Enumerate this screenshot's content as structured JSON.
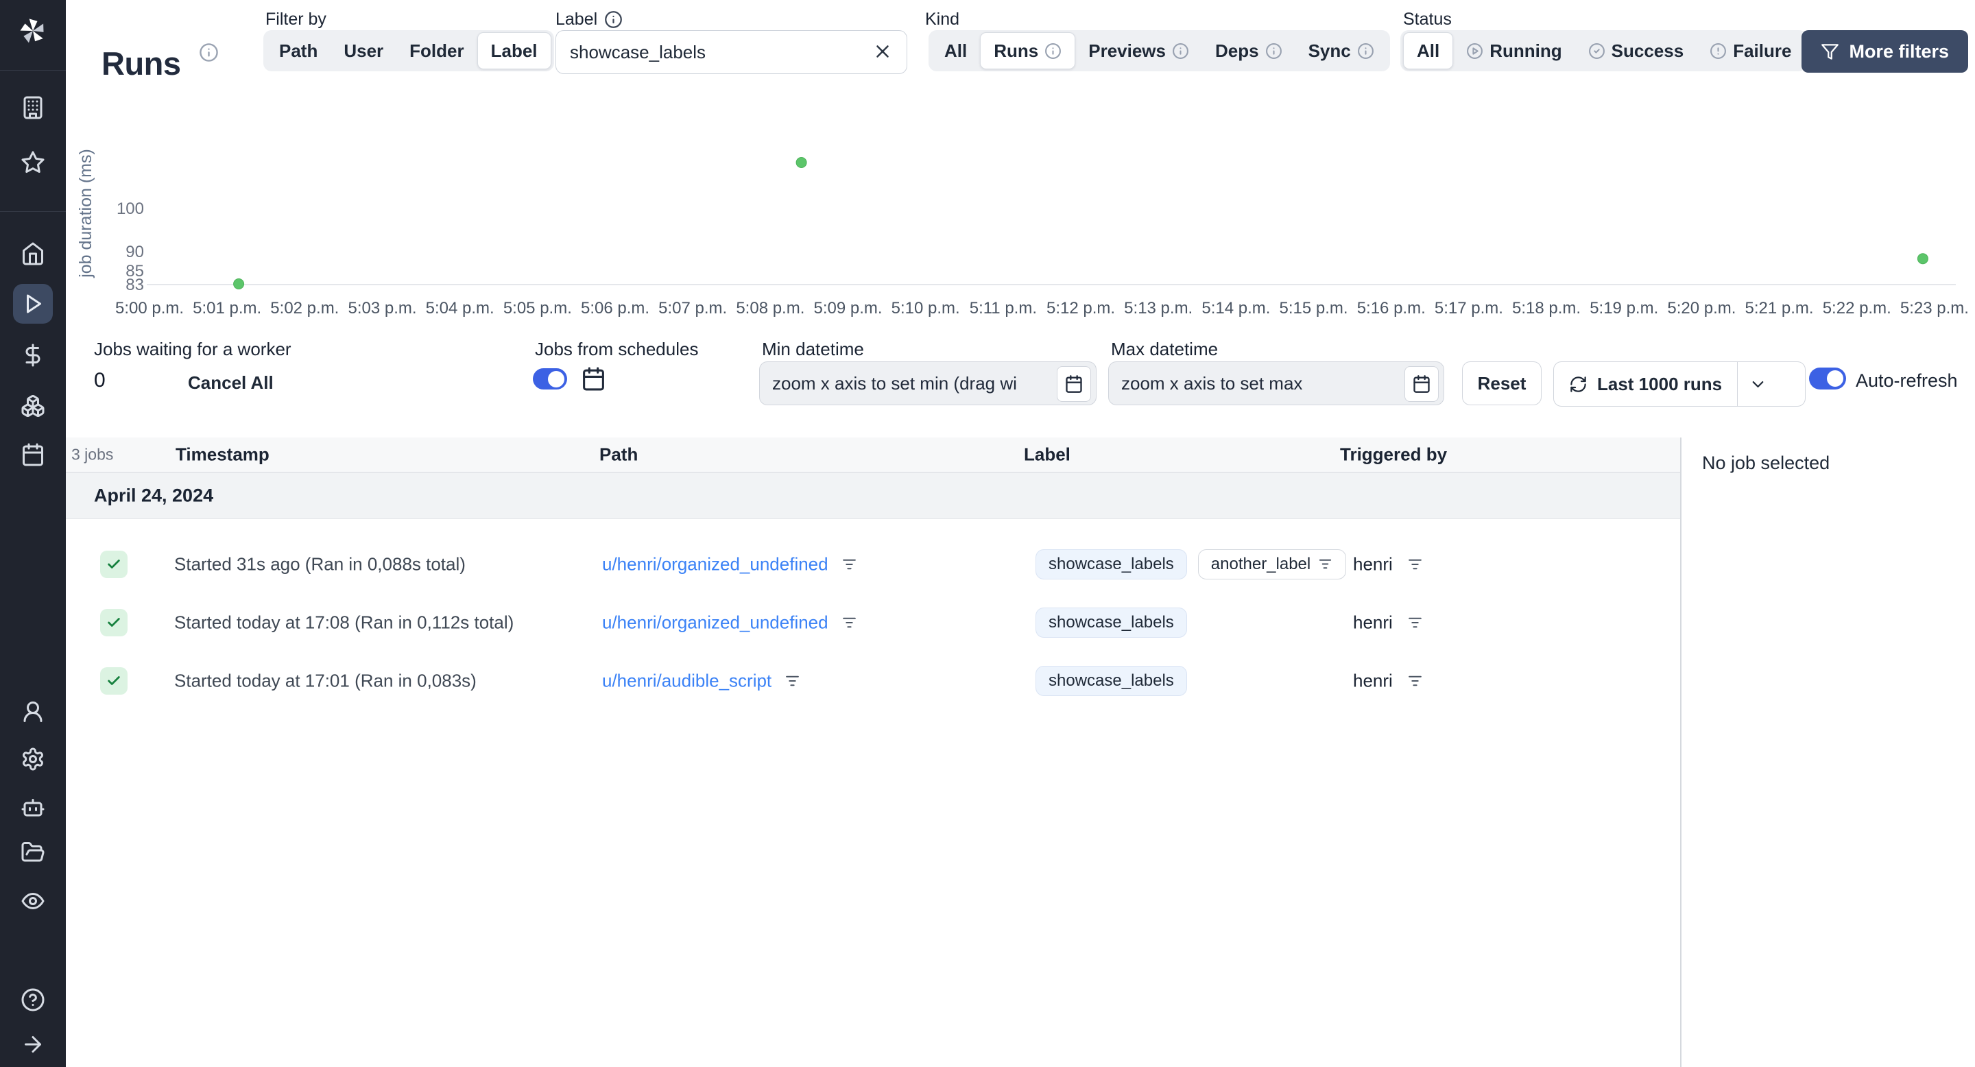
{
  "sidebar": {
    "items": [
      "workspace",
      "favorites",
      "home",
      "runs",
      "variables",
      "resources",
      "schedules",
      "users",
      "settings",
      "workers",
      "folders",
      "audit-logs",
      "help",
      "expand"
    ],
    "active": "runs"
  },
  "header": {
    "title": "Runs",
    "filter_by": {
      "label": "Filter by",
      "options": [
        "Path",
        "User",
        "Folder",
        "Label"
      ],
      "selected": "Label"
    },
    "label_filter": {
      "label": "Label",
      "value": "showcase_labels"
    },
    "kind": {
      "label": "Kind",
      "options": [
        {
          "label": "All"
        },
        {
          "label": "Runs",
          "info": true
        },
        {
          "label": "Previews",
          "info": true
        },
        {
          "label": "Deps",
          "info": true
        },
        {
          "label": "Sync",
          "info": true
        }
      ],
      "selected": "Runs"
    },
    "status": {
      "label": "Status",
      "options": [
        {
          "label": "All"
        },
        {
          "label": "Running",
          "icon": "play-circle"
        },
        {
          "label": "Success",
          "icon": "check-circle"
        },
        {
          "label": "Failure",
          "icon": "alert-circle"
        }
      ],
      "selected": "All"
    },
    "more_filters": "More filters"
  },
  "chart_data": {
    "type": "scatter",
    "title": "",
    "ylabel": "job duration (ms)",
    "xlabel": "",
    "grid": false,
    "legend": false,
    "x_ticks": [
      "5:00 p.m.",
      "5:01 p.m.",
      "5:02 p.m.",
      "5:03 p.m.",
      "5:04 p.m.",
      "5:05 p.m.",
      "5:06 p.m.",
      "5:07 p.m.",
      "5:08 p.m.",
      "5:09 p.m.",
      "5:10 p.m.",
      "5:11 p.m.",
      "5:12 p.m.",
      "5:13 p.m.",
      "5:14 p.m.",
      "5:15 p.m.",
      "5:16 p.m.",
      "5:17 p.m.",
      "5:18 p.m.",
      "5:19 p.m.",
      "5:20 p.m.",
      "5:21 p.m.",
      "5:22 p.m.",
      "5:23 p.m."
    ],
    "y_ticks": [
      83,
      85,
      90,
      100
    ],
    "ylim": [
      83,
      115
    ],
    "points": [
      {
        "x": "5:01 p.m.",
        "minute": 1.15,
        "duration_ms": 83
      },
      {
        "x": "5:08 p.m.",
        "minute": 8.4,
        "duration_ms": 112
      },
      {
        "x": "5:23 p.m.",
        "minute": 22.85,
        "duration_ms": 88
      }
    ],
    "point_color": "#5cc56a"
  },
  "controls": {
    "jobs_waiting": {
      "label": "Jobs waiting for a worker",
      "value": "0",
      "cancel": "Cancel All"
    },
    "schedules": {
      "label": "Jobs from schedules",
      "enabled": true
    },
    "min_datetime": {
      "label": "Min datetime",
      "placeholder": "zoom x axis to set min (drag wi"
    },
    "max_datetime": {
      "label": "Max datetime",
      "placeholder": "zoom x axis to set max"
    },
    "reset": "Reset",
    "runs_window": "Last 1000 runs",
    "auto_refresh": {
      "label": "Auto-refresh",
      "enabled": true
    }
  },
  "jobs": {
    "count": "3 jobs",
    "columns": [
      "Timestamp",
      "Path",
      "Label",
      "Triggered by"
    ],
    "group_date": "April 24, 2024",
    "rows": [
      {
        "status": "success",
        "timestamp": "Started 31s ago (Ran in 0,088s total)",
        "path": "u/henri/organized_undefined",
        "labels": [
          "showcase_labels",
          "another_label"
        ],
        "triggered_by": "henri"
      },
      {
        "status": "success",
        "timestamp": "Started today at 17:08 (Ran in 0,112s total)",
        "path": "u/henri/organized_undefined",
        "labels": [
          "showcase_labels"
        ],
        "triggered_by": "henri"
      },
      {
        "status": "success",
        "timestamp": "Started today at 17:01 (Ran in 0,083s)",
        "path": "u/henri/audible_script",
        "labels": [
          "showcase_labels"
        ],
        "triggered_by": "henri"
      }
    ]
  },
  "detail_panel": {
    "empty": "No job selected"
  },
  "colors": {
    "accent_blue": "#3c61e4",
    "link_blue": "#3b82f6",
    "dark_button": "#3d4b66",
    "success_green": "#15803d",
    "point_green": "#5cc56a",
    "sidebar_bg": "#20242e"
  }
}
